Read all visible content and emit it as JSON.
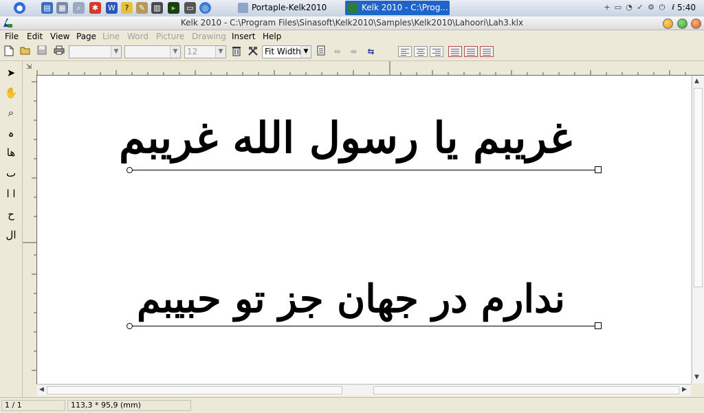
{
  "taskbar": {
    "tasks": [
      {
        "label": "Portaple-Kelk2010",
        "active": false
      },
      {
        "label": "Kelk 2010 - C:\\Prog...",
        "active": true
      }
    ],
    "clock": "5:40"
  },
  "window": {
    "title": "Kelk 2010 - C:\\Program Files\\Sinasoft\\Kelk2010\\Samples\\Kelk2010\\Lahoori\\Lah3.klx"
  },
  "menu": {
    "items": [
      "File",
      "Edit",
      "View",
      "Page",
      "Line",
      "Word",
      "Picture",
      "Drawing",
      "Insert",
      "Help"
    ],
    "disabled": [
      "Line",
      "Word",
      "Picture",
      "Drawing"
    ]
  },
  "toolbar": {
    "font_size_value": "12",
    "zoom_value": "Fit Width"
  },
  "document": {
    "line1": "غریبم یا رسول الله غریبم",
    "line2": "ندارم در جهان جز تو حبیبم"
  },
  "status": {
    "page": "1 / 1",
    "position": "113,3 * 95,9 (mm)"
  },
  "colors": {
    "taskbar_active": "#1f64c9",
    "close_button": "#e05a2b",
    "minimize_button": "#f2b51c",
    "maximize_button": "#3fb23a"
  }
}
